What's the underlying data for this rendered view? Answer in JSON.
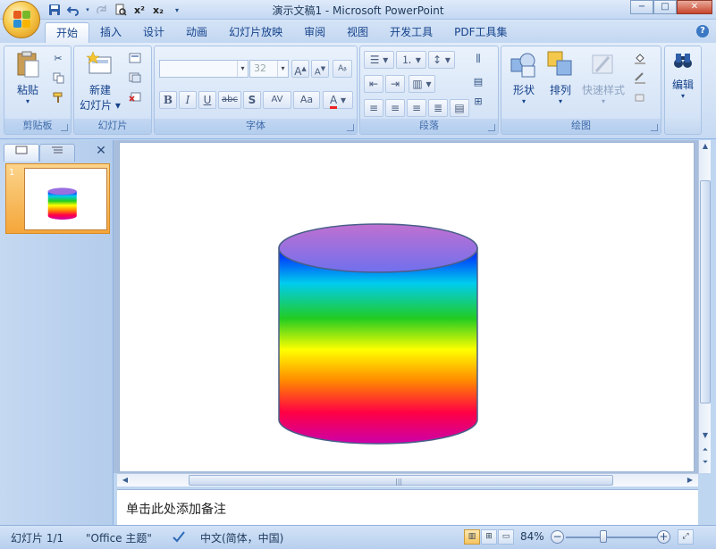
{
  "app": {
    "title": "演示文稿1 - Microsoft PowerPoint"
  },
  "quick_access": {
    "icons": [
      "save-icon",
      "undo-icon",
      "redo-icon",
      "print-preview-icon",
      "superscript-icon",
      "subscript-icon",
      "customize-icon"
    ],
    "superscript_glyph": "x²",
    "subscript_glyph": "x₂"
  },
  "window_controls": {
    "minimize": "−",
    "maximize": "□",
    "close": "✕"
  },
  "tabs": [
    {
      "label": "开始",
      "active": true
    },
    {
      "label": "插入"
    },
    {
      "label": "设计"
    },
    {
      "label": "动画"
    },
    {
      "label": "幻灯片放映"
    },
    {
      "label": "审阅"
    },
    {
      "label": "视图"
    },
    {
      "label": "开发工具"
    },
    {
      "label": "PDF工具集"
    }
  ],
  "ribbon": {
    "clipboard": {
      "label": "剪贴板",
      "paste": "粘贴"
    },
    "slides": {
      "label": "幻灯片",
      "new_slide_line1": "新建",
      "new_slide_line2": "幻灯片 ▾"
    },
    "font": {
      "label": "字体",
      "font_name": "",
      "font_size": "32",
      "bold": "B",
      "italic": "I",
      "underline": "U",
      "strike": "abc",
      "shadow": "S",
      "spacing": "AV",
      "case": "Aa",
      "color": "A",
      "grow": "A",
      "shrink": "A"
    },
    "paragraph": {
      "label": "段落"
    },
    "drawing": {
      "label": "绘图",
      "shapes": "形状",
      "arrange": "排列",
      "quick_styles": "快速样式"
    },
    "editing": {
      "label": "编辑"
    }
  },
  "slides_pane": {
    "slide_number": "1",
    "close_glyph": "✕"
  },
  "slide": {
    "shape": "cylinder",
    "gradient_colors": [
      "#0011ff",
      "#00ccee",
      "#22cc22",
      "#ffff00",
      "#ff8800",
      "#ff0044",
      "#cc00aa"
    ],
    "top_face_colors": [
      "#c070d0",
      "#7070ee"
    ],
    "outline_color": "#4a5f8a"
  },
  "notes": {
    "placeholder": "单击此处添加备注"
  },
  "status": {
    "slide_info": "幻灯片 1/1",
    "theme": "\"Office 主题\"",
    "language": "中文(简体，中国)",
    "zoom": "84%"
  }
}
